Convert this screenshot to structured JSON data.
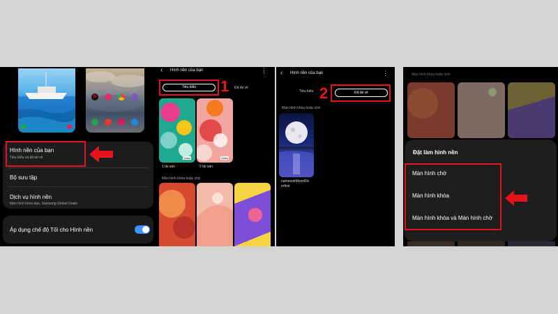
{
  "panel1": {
    "menu": {
      "your_wallpaper_title": "Hình nền của bạn",
      "your_wallpaper_sub": "Tiêu biểu và đã tải về",
      "collection": "Bộ sưu tập",
      "services_title": "Dịch vụ hình nền",
      "services_sub": "Màn hình khóa dạo, Samsung Global Goals",
      "dark_mode": "Áp dụng chế độ Tối cho Hình nền"
    },
    "dark_mode_on": true
  },
  "panel2": {
    "header": "Hình nền của bạn",
    "tab_featured": "Tiêu biểu",
    "tab_downloaded": "Đã tải về",
    "step": "1",
    "item1_caption": "1 tài sản",
    "item2_caption": "2 tài sản",
    "video_badge": "Video",
    "section": "Màn hình khóa hoặc chờ"
  },
  "panel3": {
    "header": "Hình nền của bạn",
    "tab_featured": "Tiêu biểu",
    "tab_downloaded": "Đã tải về",
    "step": "2",
    "section": "Màn hình khóa hoặc chờ",
    "item_caption_1": "nameonitMoonRiv",
    "item_caption_2": "erfirst"
  },
  "panel4": {
    "section": "Màn hình khóa hoặc chờ",
    "sheet_title": "Đặt làm hình nền",
    "options": [
      "Màn hình chờ",
      "Màn hình khóa",
      "Màn hình khóa và Màn hình chờ"
    ]
  },
  "colors": {
    "accent_red": "#e8141c",
    "toggle_blue": "#3e91ff",
    "panel_bg": "#000000",
    "card_bg": "#1c1c1e"
  }
}
